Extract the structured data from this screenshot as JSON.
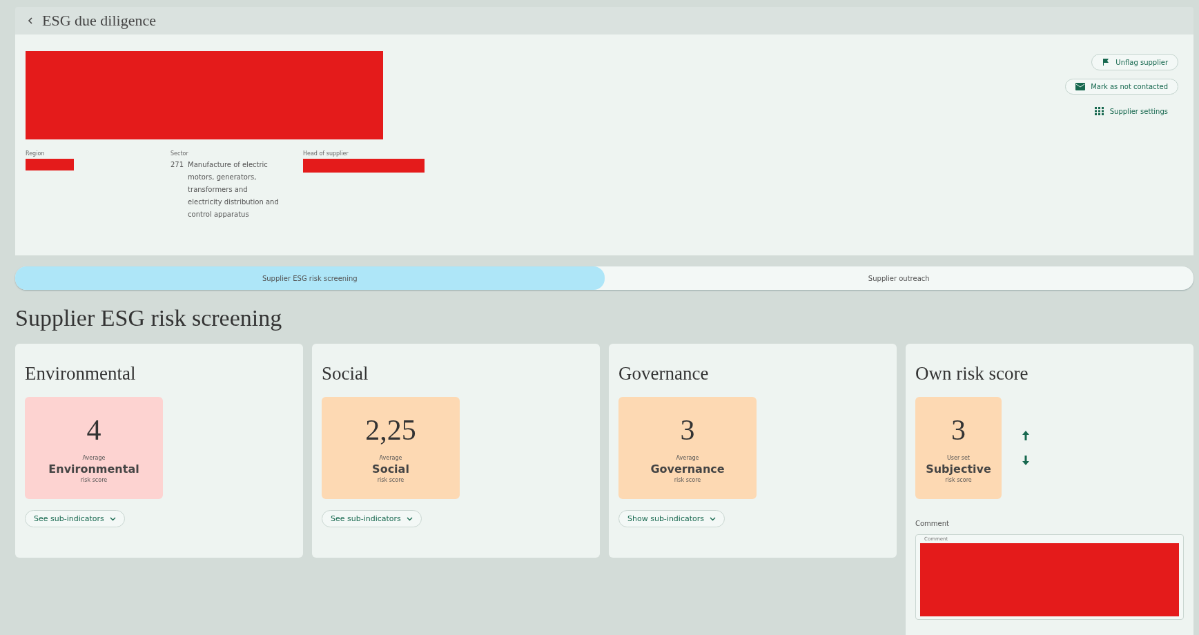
{
  "header": {
    "title": "ESG due diligence"
  },
  "supplier": {
    "fields": [
      {
        "label": "Region",
        "redacted": true
      },
      {
        "label": "Sector",
        "code": "271",
        "value": "Manufacture of electric motors, generators, transformers and electricity distribution and control apparatus"
      },
      {
        "label": "Head of supplier",
        "redacted": true
      }
    ],
    "actions": [
      {
        "kind": "flag",
        "label": "Unflag supplier"
      },
      {
        "kind": "mail",
        "label": "Mark as not contacted"
      },
      {
        "kind": "grid",
        "label": "Supplier settings"
      }
    ]
  },
  "tabs": [
    {
      "label": "Supplier ESG risk screening",
      "selected": true
    },
    {
      "label": "Supplier outreach",
      "selected": false
    }
  ],
  "section_title": "Supplier ESG risk screening",
  "cards": [
    {
      "kind": "average",
      "title": "Environmental",
      "score": "4",
      "pre": "Average",
      "name": "Environmental",
      "post": "risk score",
      "color": "#fdd3d1",
      "button": "See sub-indicators"
    },
    {
      "kind": "average",
      "title": "Social",
      "score": "2,25",
      "pre": "Average",
      "name": "Social",
      "post": "risk score",
      "color": "#fdd9b3",
      "button": "See sub-indicators"
    },
    {
      "kind": "average",
      "title": "Governance",
      "score": "3",
      "pre": "Average",
      "name": "Governance",
      "post": "risk score",
      "color": "#fdd9b3",
      "button": "Show sub-indicators"
    },
    {
      "kind": "own",
      "title": "Own risk score",
      "score": "3",
      "pre": "User set",
      "name": "Subjective",
      "post": "risk score",
      "color": "#fdd9b3",
      "comment_label": "Comment",
      "field_label": "Comment"
    }
  ]
}
